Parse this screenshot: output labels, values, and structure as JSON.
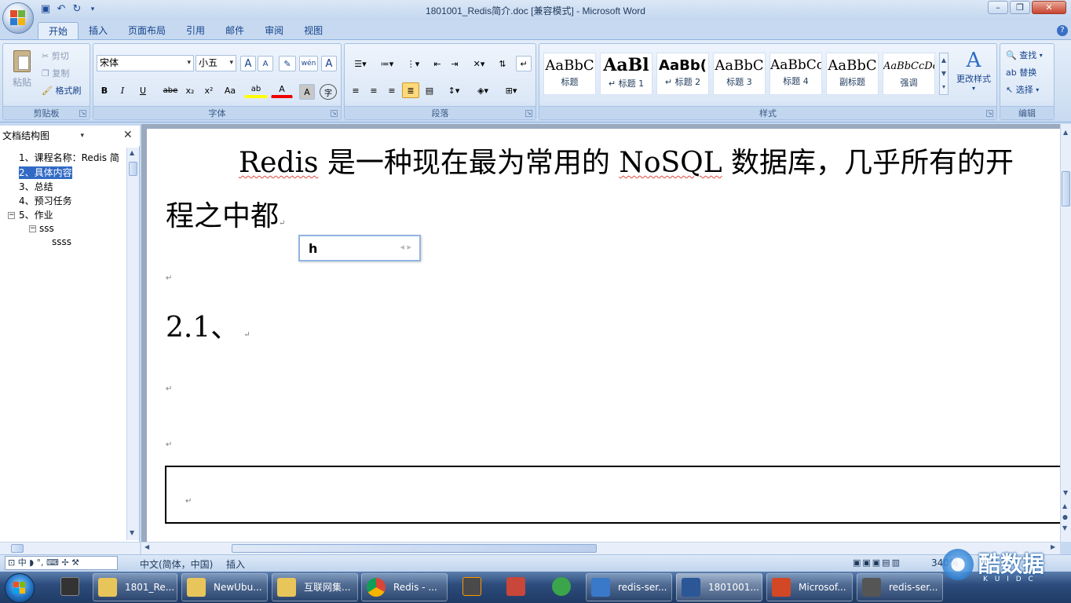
{
  "window": {
    "title": "1801001_Redis简介.doc [兼容模式] - Microsoft Word",
    "controls": {
      "minimize": "–",
      "restore": "❐",
      "close": "✕"
    }
  },
  "qat": {
    "save_icon": "save-icon",
    "undo_icon": "undo-icon",
    "redo_icon": "redo-icon"
  },
  "ribbon": {
    "tabs": [
      "开始",
      "插入",
      "页面布局",
      "引用",
      "邮件",
      "审阅",
      "视图"
    ],
    "help": "?",
    "clipboard": {
      "label": "剪贴板",
      "paste": "粘贴",
      "cut": "剪切",
      "copy": "复制",
      "format_painter": "格式刷"
    },
    "font": {
      "label": "字体",
      "font_name": "宋体",
      "font_size": "小五",
      "grow": "A",
      "shrink": "A",
      "clear": "✎",
      "phonetic": "wén",
      "border_char": "A",
      "bold": "B",
      "italic": "I",
      "underline": "U",
      "strike": "abe",
      "subscript": "x₂",
      "superscript": "x²",
      "case": "Aa",
      "highlight": "ab",
      "font_color": "A",
      "shading": "A",
      "enclose": "字"
    },
    "paragraph": {
      "label": "段落"
    },
    "styles": {
      "label": "样式",
      "items": [
        {
          "sample": "AaBbC",
          "name": "标题"
        },
        {
          "sample": "AaBl",
          "name": "↵ 标题 1"
        },
        {
          "sample": "AaBb(",
          "name": "↵ 标题 2"
        },
        {
          "sample": "AaBbC",
          "name": "标题 3"
        },
        {
          "sample": "AaBbCc",
          "name": "标题 4"
        },
        {
          "sample": "AaBbC",
          "name": "副标题"
        },
        {
          "sample": "AaBbCcDc",
          "name": "强调"
        }
      ],
      "change": "更改样式"
    },
    "editing": {
      "label": "编辑",
      "find": "查找",
      "replace": "替换",
      "select": "选择"
    }
  },
  "navigation": {
    "view_select": "文档结构图",
    "close": "✕",
    "items": [
      {
        "text": "1、课程名称：Redis 简",
        "selected": false
      },
      {
        "text": "2、具体内容",
        "selected": true
      },
      {
        "text": "3、总结",
        "selected": false
      },
      {
        "text": "4、预习任务",
        "selected": false
      },
      {
        "text": "5、作业",
        "selected": false
      },
      {
        "text": "sss",
        "selected": false
      },
      {
        "text": "ssss",
        "selected": false
      }
    ]
  },
  "document": {
    "line1_a": "Redis",
    "line1_b": " 是一种现在最为常用的 ",
    "line1_c": "NoSQL",
    "line1_d": " 数据库，几乎所有的开",
    "line2": "程之中都",
    "heading": "2.1、",
    "para_mark": "↵"
  },
  "ime": {
    "text": "h",
    "arrows": "◂ ▸"
  },
  "statusbar": {
    "language": "中文(简体，中国)",
    "mode": "插入",
    "zoom": "340%"
  },
  "taskbar": {
    "items": [
      {
        "label": "1801_Re...",
        "color": "#e8c55a"
      },
      {
        "label": "NewUbu...",
        "color": "#e8c55a"
      },
      {
        "label": "互联网集...",
        "color": "#e8c55a"
      },
      {
        "label": "Redis - ...",
        "color": "#4285f4"
      },
      {
        "label": "redis-ser...",
        "color": "#3a79c9"
      },
      {
        "label": "1801001...",
        "color": "#2b5797"
      },
      {
        "label": "Microsof...",
        "color": "#d24726"
      },
      {
        "label": "redis-ser...",
        "color": "#555555"
      }
    ]
  },
  "watermark": {
    "text": "酷数据",
    "sub": "K U I D C"
  }
}
